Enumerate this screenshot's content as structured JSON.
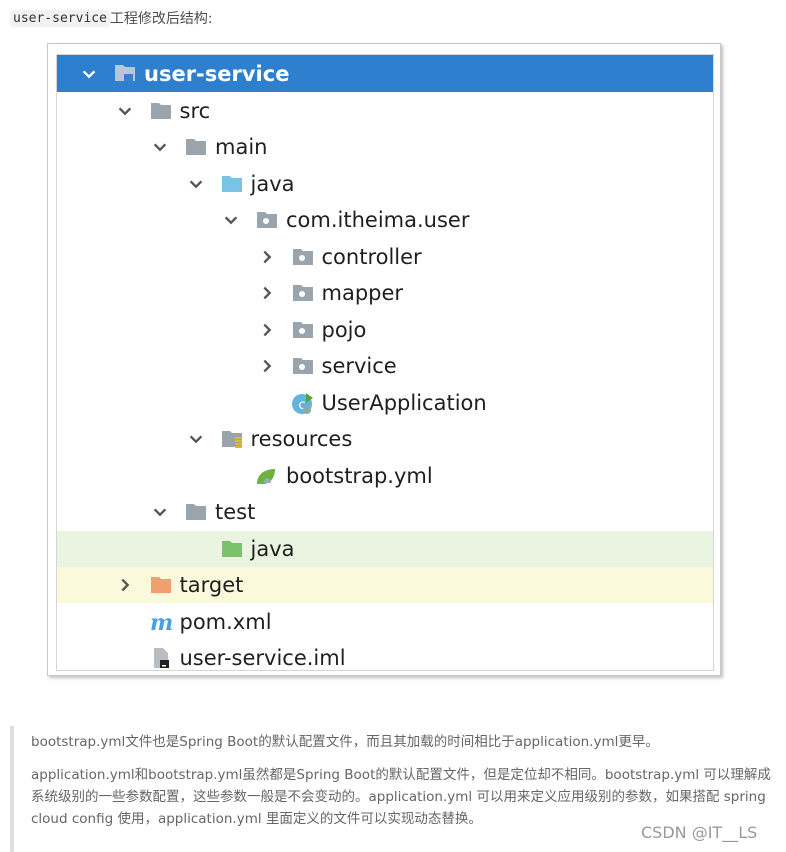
{
  "caption": {
    "code": "user-service",
    "text": "工程修改后结构:"
  },
  "tree": [
    {
      "label": "user-service",
      "icon": "module-folder-icon",
      "expander": "expanded",
      "state": "selected"
    },
    {
      "label": "src",
      "icon": "folder-icon",
      "expander": "expanded",
      "state": ""
    },
    {
      "label": "main",
      "icon": "folder-icon",
      "expander": "expanded",
      "state": ""
    },
    {
      "label": "java",
      "icon": "source-folder-icon",
      "expander": "expanded",
      "state": ""
    },
    {
      "label": "com.itheima.user",
      "icon": "package-icon",
      "expander": "expanded",
      "state": ""
    },
    {
      "label": "controller",
      "icon": "package-icon",
      "expander": "collapsed",
      "state": ""
    },
    {
      "label": "mapper",
      "icon": "package-icon",
      "expander": "collapsed",
      "state": ""
    },
    {
      "label": "pojo",
      "icon": "package-icon",
      "expander": "collapsed",
      "state": ""
    },
    {
      "label": "service",
      "icon": "package-icon",
      "expander": "collapsed",
      "state": ""
    },
    {
      "label": "UserApplication",
      "icon": "spring-boot-class-icon",
      "expander": "none",
      "state": ""
    },
    {
      "label": "resources",
      "icon": "resources-folder-icon",
      "expander": "expanded",
      "state": ""
    },
    {
      "label": "bootstrap.yml",
      "icon": "spring-leaf-icon",
      "expander": "none",
      "state": ""
    },
    {
      "label": "test",
      "icon": "folder-icon",
      "expander": "expanded",
      "state": ""
    },
    {
      "label": "java",
      "icon": "test-source-folder-icon",
      "expander": "none",
      "state": "test"
    },
    {
      "label": "target",
      "icon": "excluded-folder-icon",
      "expander": "collapsed",
      "state": "excluded"
    },
    {
      "label": "pom.xml",
      "icon": "maven-icon",
      "expander": "none",
      "state": ""
    },
    {
      "label": "user-service.iml",
      "icon": "iml-file-icon",
      "expander": "none",
      "state": ""
    }
  ],
  "quote": {
    "line1": "bootstrap.yml文件也是Spring Boot的默认配置文件，而且其加载的时间相比于application.yml更早。",
    "line2": "application.yml和bootstrap.yml虽然都是Spring Boot的默认配置文件，但是定位却不相同。bootstrap.yml 可以理解成系统级别的一些参数配置，这些参数一般是不会变动的。application.yml 可以用来定义应用级别的参数，如果搭配 spring cloud config 使用，application.yml 里面定义的文件可以实现动态替换。"
  },
  "watermark": "CSDN @IT__LS",
  "colors": {
    "selection": "#2f7fcf",
    "test_row": "#e9f5e1",
    "excluded_row": "#fbf9dc",
    "folder": "#9aa4ad",
    "source_folder": "#79c3e8",
    "test_folder": "#7cc26c",
    "excluded_folder": "#f0a070"
  }
}
